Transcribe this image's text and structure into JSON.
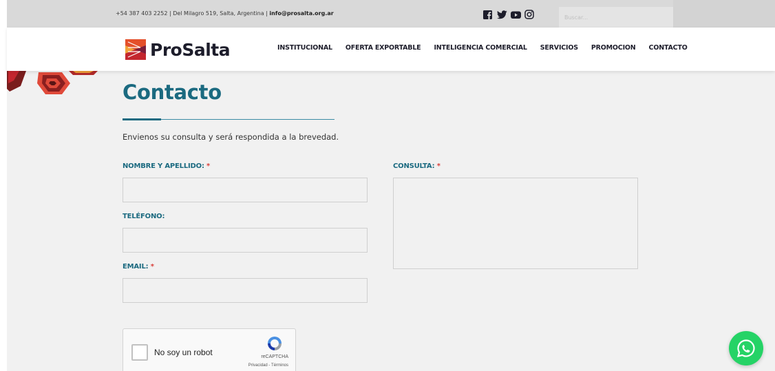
{
  "topbar": {
    "contact_info": "+54 387 403 2252 | Del Milagro 519, Salta, Argentina | ",
    "email": "info@prosalta.org.ar",
    "social_icons": [
      "facebook-icon",
      "twitter-icon",
      "youtube-icon",
      "instagram-icon"
    ],
    "search_placeholder": "Buscar..."
  },
  "header": {
    "logo_text": "ProSalta",
    "nav": [
      "INSTITUCIONAL",
      "OFERTA EXPORTABLE",
      "INTELIGENCIA COMERCIAL",
      "SERVICIOS",
      "PROMOCION",
      "CONTACTO"
    ]
  },
  "page": {
    "title": "Contacto",
    "intro": "Envienos su consulta y será respondida a la brevedad."
  },
  "form": {
    "name_label": "NOMBRE Y APELLIDO: ",
    "phone_label": "TELÉFONO:",
    "email_label": "EMAIL: ",
    "message_label": "CONSULTA: ",
    "required_mark": "*",
    "name_value": "",
    "phone_value": "",
    "email_value": "",
    "message_value": ""
  },
  "captcha": {
    "label": "No soy un robot",
    "brand": "reCAPTCHA",
    "links": "Privacidad - Términos"
  },
  "colors": {
    "primary": "#1b6a80",
    "required": "#d9403a",
    "whatsapp": "#25d366",
    "topbar": "#d9d9d9",
    "content_bg": "#f1f1f1"
  },
  "floating": {
    "whatsapp_icon": "whatsapp-icon"
  }
}
